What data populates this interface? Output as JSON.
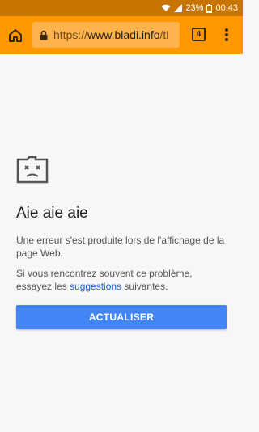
{
  "status_bar": {
    "battery_percent": "23%",
    "time": "00:43",
    "icons": [
      "wifi-icon",
      "signal-icon",
      "battery-icon"
    ]
  },
  "toolbar": {
    "url_scheme": "https://",
    "url_host": "www.bladi.info",
    "url_path": "/tl",
    "tab_count": "4",
    "icons": [
      "home-icon",
      "lock-icon",
      "menu-icon"
    ]
  },
  "error_page": {
    "title": "Aie aie aie",
    "message": "Une erreur s'est produite lors de l'affichage de la page Web.",
    "suggestion_prefix": "Si vous rencontrez souvent ce problème, essayez les ",
    "suggestion_link": "suggestions",
    "suggestion_suffix": " suivantes.",
    "reload_button": "ACTUALISER",
    "icon": "sad-tab-icon"
  },
  "colors": {
    "status_bar": "#c87400",
    "toolbar": "#ff9800",
    "omnibox": "#ffb34d",
    "page_background": "#f7f7f7",
    "button": "#4285f4",
    "link": "#1a5fbf"
  }
}
